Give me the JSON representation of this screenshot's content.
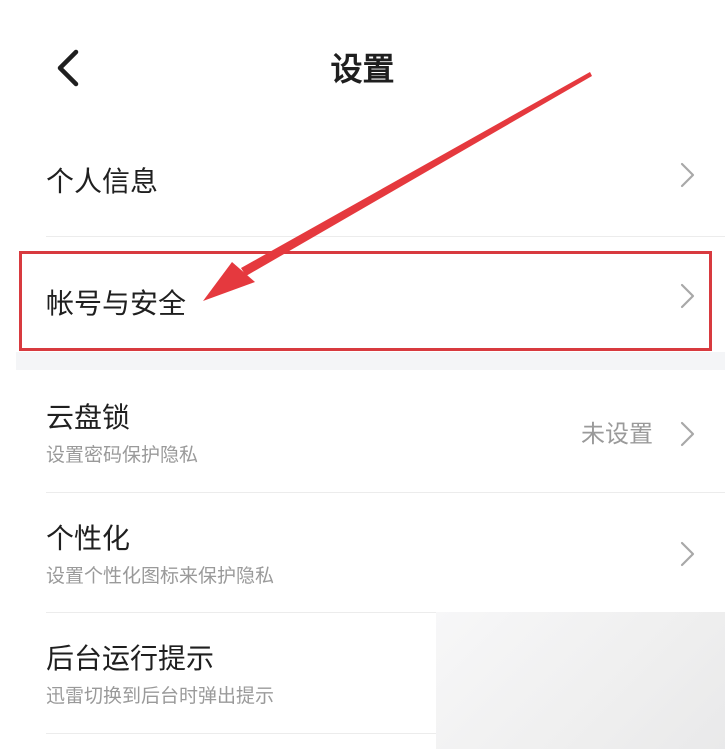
{
  "header": {
    "back_icon": "chevron-left-icon",
    "title": "设置"
  },
  "sections": [
    {
      "items": [
        {
          "title": "个人信息",
          "subtitle": "",
          "value": "",
          "icon": "chevron-right-icon"
        },
        {
          "title": "帐号与安全",
          "subtitle": "",
          "value": "",
          "icon": "chevron-right-icon",
          "highlighted": true
        }
      ]
    },
    {
      "items": [
        {
          "title": "云盘锁",
          "subtitle": "设置密码保护隐私",
          "value": "未设置",
          "icon": "chevron-right-icon"
        },
        {
          "title": "个性化",
          "subtitle": "设置个性化图标来保护隐私",
          "value": "",
          "icon": "chevron-right-icon"
        },
        {
          "title": "后台运行提示",
          "subtitle": "迅雷切换到后台时弹出提示",
          "value": "",
          "icon": ""
        }
      ]
    }
  ],
  "annotation": {
    "highlight_color": "#d83a3f",
    "arrow_color": "#e5393e"
  },
  "colors": {
    "text_primary": "#1f1f1f",
    "text_secondary": "#9a9a9a",
    "divider": "#ececec",
    "group_gap": "#f4f5f7"
  }
}
